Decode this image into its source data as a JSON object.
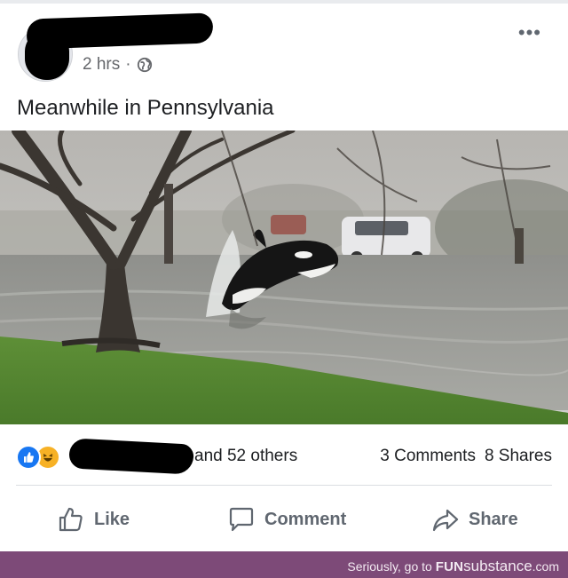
{
  "post": {
    "timestamp": "2 hrs",
    "separator": "·",
    "privacy_icon": "globe-icon",
    "more_icon": "more-options-icon",
    "more_label": "•••",
    "text": "Meanwhile in Pennsylvania"
  },
  "reactions": {
    "icons": [
      "like-icon",
      "haha-icon"
    ],
    "reactors_suffix": "and 52 others",
    "comments": "3 Comments",
    "shares": "8 Shares"
  },
  "actions": {
    "like": "Like",
    "comment": "Comment",
    "share": "Share"
  },
  "footer": {
    "prefix": "Seriously, go to ",
    "brand_bold": "FUN",
    "brand": "substance",
    "suffix": ".com"
  },
  "colors": {
    "like_blue": "#1877f2",
    "haha_yellow": "#f7b125",
    "footer_purple": "#7d4a78",
    "secondary_text": "#65676b"
  }
}
